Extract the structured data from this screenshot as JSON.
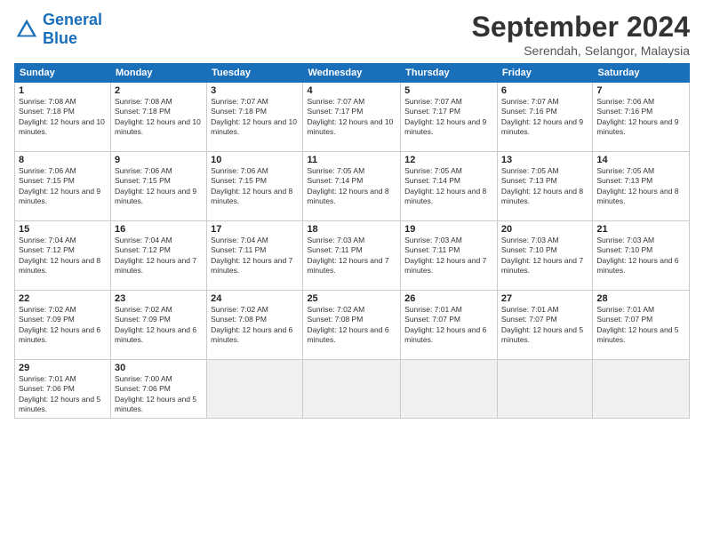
{
  "logo": {
    "text_general": "General",
    "text_blue": "Blue"
  },
  "header": {
    "month": "September 2024",
    "location": "Serendah, Selangor, Malaysia"
  },
  "days_of_week": [
    "Sunday",
    "Monday",
    "Tuesday",
    "Wednesday",
    "Thursday",
    "Friday",
    "Saturday"
  ],
  "weeks": [
    [
      {
        "day": "1",
        "sunrise": "7:08 AM",
        "sunset": "7:18 PM",
        "daylight": "12 hours and 10 minutes."
      },
      {
        "day": "2",
        "sunrise": "7:08 AM",
        "sunset": "7:18 PM",
        "daylight": "12 hours and 10 minutes."
      },
      {
        "day": "3",
        "sunrise": "7:07 AM",
        "sunset": "7:18 PM",
        "daylight": "12 hours and 10 minutes."
      },
      {
        "day": "4",
        "sunrise": "7:07 AM",
        "sunset": "7:17 PM",
        "daylight": "12 hours and 10 minutes."
      },
      {
        "day": "5",
        "sunrise": "7:07 AM",
        "sunset": "7:17 PM",
        "daylight": "12 hours and 9 minutes."
      },
      {
        "day": "6",
        "sunrise": "7:07 AM",
        "sunset": "7:16 PM",
        "daylight": "12 hours and 9 minutes."
      },
      {
        "day": "7",
        "sunrise": "7:06 AM",
        "sunset": "7:16 PM",
        "daylight": "12 hours and 9 minutes."
      }
    ],
    [
      {
        "day": "8",
        "sunrise": "7:06 AM",
        "sunset": "7:15 PM",
        "daylight": "12 hours and 9 minutes."
      },
      {
        "day": "9",
        "sunrise": "7:06 AM",
        "sunset": "7:15 PM",
        "daylight": "12 hours and 9 minutes."
      },
      {
        "day": "10",
        "sunrise": "7:06 AM",
        "sunset": "7:15 PM",
        "daylight": "12 hours and 8 minutes."
      },
      {
        "day": "11",
        "sunrise": "7:05 AM",
        "sunset": "7:14 PM",
        "daylight": "12 hours and 8 minutes."
      },
      {
        "day": "12",
        "sunrise": "7:05 AM",
        "sunset": "7:14 PM",
        "daylight": "12 hours and 8 minutes."
      },
      {
        "day": "13",
        "sunrise": "7:05 AM",
        "sunset": "7:13 PM",
        "daylight": "12 hours and 8 minutes."
      },
      {
        "day": "14",
        "sunrise": "7:05 AM",
        "sunset": "7:13 PM",
        "daylight": "12 hours and 8 minutes."
      }
    ],
    [
      {
        "day": "15",
        "sunrise": "7:04 AM",
        "sunset": "7:12 PM",
        "daylight": "12 hours and 8 minutes."
      },
      {
        "day": "16",
        "sunrise": "7:04 AM",
        "sunset": "7:12 PM",
        "daylight": "12 hours and 7 minutes."
      },
      {
        "day": "17",
        "sunrise": "7:04 AM",
        "sunset": "7:11 PM",
        "daylight": "12 hours and 7 minutes."
      },
      {
        "day": "18",
        "sunrise": "7:03 AM",
        "sunset": "7:11 PM",
        "daylight": "12 hours and 7 minutes."
      },
      {
        "day": "19",
        "sunrise": "7:03 AM",
        "sunset": "7:11 PM",
        "daylight": "12 hours and 7 minutes."
      },
      {
        "day": "20",
        "sunrise": "7:03 AM",
        "sunset": "7:10 PM",
        "daylight": "12 hours and 7 minutes."
      },
      {
        "day": "21",
        "sunrise": "7:03 AM",
        "sunset": "7:10 PM",
        "daylight": "12 hours and 6 minutes."
      }
    ],
    [
      {
        "day": "22",
        "sunrise": "7:02 AM",
        "sunset": "7:09 PM",
        "daylight": "12 hours and 6 minutes."
      },
      {
        "day": "23",
        "sunrise": "7:02 AM",
        "sunset": "7:09 PM",
        "daylight": "12 hours and 6 minutes."
      },
      {
        "day": "24",
        "sunrise": "7:02 AM",
        "sunset": "7:08 PM",
        "daylight": "12 hours and 6 minutes."
      },
      {
        "day": "25",
        "sunrise": "7:02 AM",
        "sunset": "7:08 PM",
        "daylight": "12 hours and 6 minutes."
      },
      {
        "day": "26",
        "sunrise": "7:01 AM",
        "sunset": "7:07 PM",
        "daylight": "12 hours and 6 minutes."
      },
      {
        "day": "27",
        "sunrise": "7:01 AM",
        "sunset": "7:07 PM",
        "daylight": "12 hours and 5 minutes."
      },
      {
        "day": "28",
        "sunrise": "7:01 AM",
        "sunset": "7:07 PM",
        "daylight": "12 hours and 5 minutes."
      }
    ],
    [
      {
        "day": "29",
        "sunrise": "7:01 AM",
        "sunset": "7:06 PM",
        "daylight": "12 hours and 5 minutes."
      },
      {
        "day": "30",
        "sunrise": "7:00 AM",
        "sunset": "7:06 PM",
        "daylight": "12 hours and 5 minutes."
      },
      null,
      null,
      null,
      null,
      null
    ]
  ]
}
